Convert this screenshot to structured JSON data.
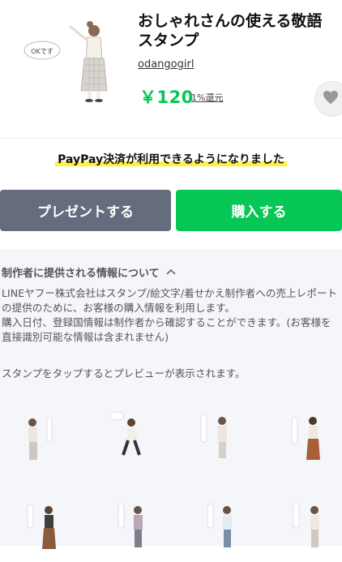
{
  "product": {
    "title": "おしゃれさんの使える敬語スタンプ",
    "creator": "odangogirl",
    "price": "￥120",
    "cashback": "1%還元",
    "thumbnail_bubble_text": "OKです"
  },
  "notice": {
    "text": "PayPay決済が利用できるようになりました"
  },
  "buttons": {
    "gift_label": "プレゼントする",
    "buy_label": "購入する"
  },
  "info": {
    "heading": "制作者に提供される情報について",
    "paragraph1": "LINEヤフー株式会社はスタンプ/絵文字/着せかえ制作者への売上レポートの提供のために、お客様の購入情報を利用します。",
    "paragraph2": "購入日付、登録国情報は制作者から確認することができます。(お客様を直接識別可能な情報は含まれません)",
    "preview_note": "スタンプをタップするとプレビューが表示されます。"
  },
  "icons": {
    "favorite": "heart-icon",
    "expand": "chevron-up-icon"
  },
  "colors": {
    "brand_green": "#06c755",
    "gift_button": "#646c7e",
    "highlight": "#fff13c",
    "info_background": "#f5f6f9"
  }
}
